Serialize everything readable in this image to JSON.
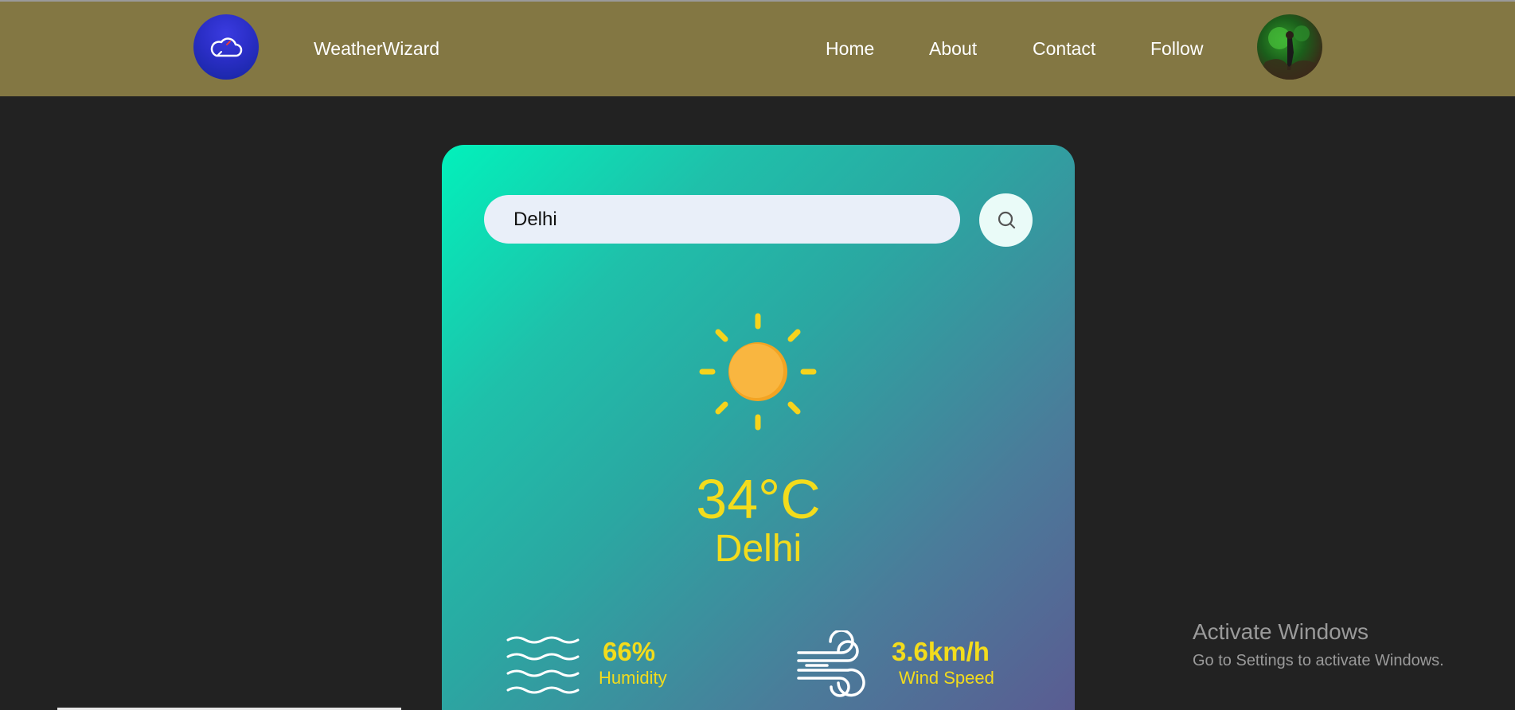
{
  "header": {
    "logo_icon": "cloud-icon",
    "brand": "WeatherWizard",
    "nav": [
      "Home",
      "About",
      "Contact",
      "Follow"
    ],
    "avatar_icon": "profile-avatar"
  },
  "search": {
    "value": "Delhi",
    "button_icon": "search-icon"
  },
  "weather": {
    "icon": "sun-icon",
    "temperature": "34°C",
    "city": "Delhi"
  },
  "stats": {
    "humidity": {
      "value": "66%",
      "label": "Humidity",
      "icon": "humidity-icon"
    },
    "wind": {
      "value": "3.6km/h",
      "label": "Wind Speed",
      "icon": "wind-icon"
    }
  },
  "overlay": {
    "title": "Activate Windows",
    "subtitle": "Go to Settings to activate Windows."
  },
  "colors": {
    "navbar": "#837743",
    "background": "#222222",
    "accent": "#f3dc1c",
    "card_start": "#02f1bb",
    "card_end": "#5a5c92"
  }
}
